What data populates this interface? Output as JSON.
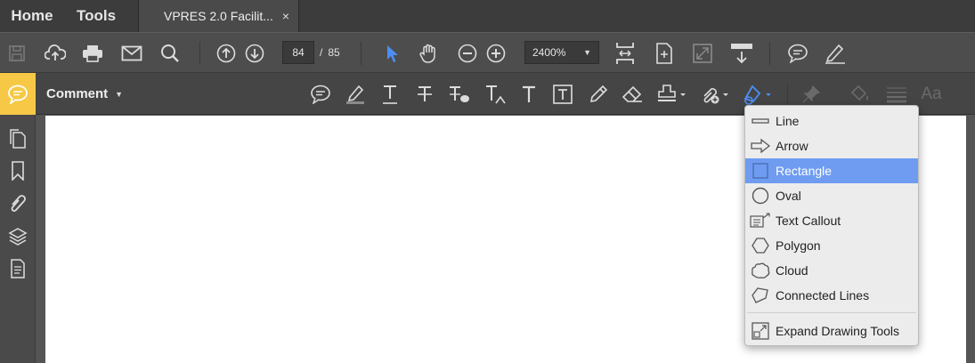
{
  "topbar": {
    "home_label": "Home",
    "tools_label": "Tools",
    "doc_tab_title": "VPRES 2.0 Facilit...",
    "close_glyph": "×"
  },
  "toolbar": {
    "page_current": "84",
    "page_separator": "/",
    "page_total": "85",
    "zoom_value": "2400%",
    "icons": [
      "save-icon",
      "upload-icon",
      "print-icon",
      "mail-icon",
      "search-icon",
      "prev-page-icon",
      "next-page-icon",
      "select-arrow-icon",
      "hand-icon",
      "zoom-out-icon",
      "zoom-in-icon",
      "fit-page-icon",
      "page-view-icon",
      "fullscreen-icon",
      "scroll-mode-icon",
      "comment-icon",
      "sign-icon"
    ]
  },
  "comment_bar": {
    "label": "Comment",
    "caret": "▼",
    "icons": [
      "sticky-note-icon",
      "highlight-icon",
      "underline-text-icon",
      "strikethrough-icon",
      "replace-text-icon",
      "insert-text-icon",
      "add-text-icon",
      "text-box-icon",
      "pencil-icon",
      "eraser-icon",
      "stamp-icon",
      "attach-icon",
      "drawing-tools-icon",
      "pin-icon",
      "fill-color-icon",
      "line-weight-icon",
      "font-icon"
    ]
  },
  "left_rail": {
    "icons": [
      "pages-icon",
      "bookmark-icon",
      "attachment-icon",
      "layers-icon",
      "document-icon"
    ]
  },
  "drawing_menu": {
    "items": [
      {
        "label": "Line",
        "icon": "line-icon",
        "selected": false
      },
      {
        "label": "Arrow",
        "icon": "arrow-icon",
        "selected": false
      },
      {
        "label": "Rectangle",
        "icon": "rectangle-icon",
        "selected": true
      },
      {
        "label": "Oval",
        "icon": "oval-icon",
        "selected": false
      },
      {
        "label": "Text Callout",
        "icon": "text-callout-icon",
        "selected": false
      },
      {
        "label": "Polygon",
        "icon": "polygon-icon",
        "selected": false
      },
      {
        "label": "Cloud",
        "icon": "cloud-icon",
        "selected": false
      },
      {
        "label": "Connected Lines",
        "icon": "connected-lines-icon",
        "selected": false
      }
    ],
    "expand_label": "Expand Drawing Tools"
  },
  "colors": {
    "accent_yellow": "#f6c845",
    "selection_blue": "#6f9cf0",
    "active_tool_blue": "#4d8ef5"
  }
}
